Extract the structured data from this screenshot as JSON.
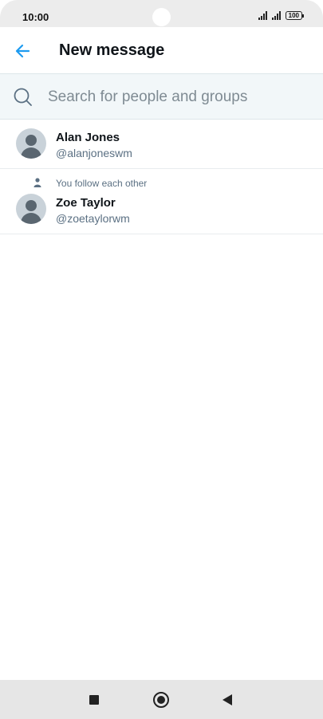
{
  "status_bar": {
    "time": "10:00",
    "battery": "100"
  },
  "header": {
    "title": "New message"
  },
  "search": {
    "placeholder": "Search for people and groups"
  },
  "results": [
    {
      "name": "Alan Jones",
      "handle": "@alanjoneswm",
      "context": ""
    },
    {
      "name": "Zoe Taylor",
      "handle": "@zoetaylorwm",
      "context": "You follow each other"
    }
  ],
  "colors": {
    "accent": "#1d9bf0",
    "secondary_text": "#5b7083",
    "search_bg": "#f2f7f9"
  },
  "icons": {
    "back": "arrow-left-icon",
    "search": "search-icon",
    "avatar": "default-avatar-icon",
    "context": "person-icon"
  }
}
